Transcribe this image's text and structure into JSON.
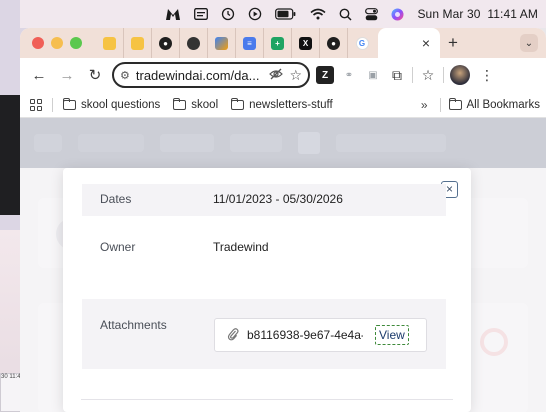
{
  "menubar": {
    "clock_date": "Sun Mar 30",
    "clock_time": "11:41 AM",
    "icons": [
      "malwarebytes-icon",
      "calendar-icon",
      "history-clock-icon",
      "play-circle-icon",
      "battery-icon",
      "wifi-icon",
      "search-icon",
      "control-center-icon",
      "siri-icon"
    ]
  },
  "browser": {
    "tabs": {
      "favicon_tabs": [
        "folder-tab",
        "folder-tab",
        "dark-logo-tab",
        "github-tab",
        "orange-tab",
        "docs-tab",
        "sheets-tab",
        "x-tab",
        "dark-logo-tab",
        "google-tab"
      ],
      "active_close": "×",
      "new_tab": "+",
      "dropdown": "⌄"
    },
    "toolbar": {
      "back": "←",
      "forward": "→",
      "reload": "↻",
      "url": "tradewindai.com/da...",
      "site_info": "⚙",
      "extensions_label": "⇧"
    },
    "bookmarks": {
      "items": [
        {
          "label": "skool questions"
        },
        {
          "label": "skool"
        },
        {
          "label": "newsletters-stuff"
        }
      ],
      "more": "»",
      "all_bookmarks": "All Bookmarks"
    }
  },
  "modal": {
    "close_label": "×",
    "rows": {
      "dates": {
        "label": "Dates",
        "value": "11/01/2023 - 05/30/2026"
      },
      "owner": {
        "label": "Owner",
        "value": "Tradewind"
      },
      "attachments": {
        "label": "Attachments"
      }
    },
    "attachment": {
      "file_name": "b8116938-9e67-4e4a-b...",
      "view_label": "View"
    }
  },
  "background_window": {
    "mini_time": "30  11:43 AM"
  }
}
